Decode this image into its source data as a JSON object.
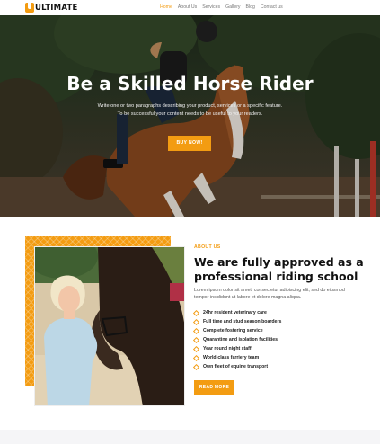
{
  "brand": {
    "logo_letter": "U",
    "name": "ULTIMATE"
  },
  "nav": [
    {
      "label": "Home",
      "active": true
    },
    {
      "label": "About Us",
      "active": false
    },
    {
      "label": "Services",
      "active": false
    },
    {
      "label": "Gallery",
      "active": false
    },
    {
      "label": "Blog",
      "active": false
    },
    {
      "label": "Contact us",
      "active": false
    }
  ],
  "hero": {
    "title": "Be a Skilled Horse Rider",
    "text_line1": "Write one or two paragraphs describing your product, services or a specific feature.",
    "text_line2": "To be successful your content needs to be useful to your readers.",
    "button": "BUY NOW!"
  },
  "about": {
    "eyebrow": "ABOUT US",
    "title": "We are fully approved as a professional riding school",
    "text": "Lorem ipsum dolor sit amet, consectetur adipiscing elit, sed do eiusmod tempor incididunt ut labore et dolore magna aliqua.",
    "features": [
      "24hr resident veterinary care",
      "Full time and stud season boarders",
      "Complete fostering service",
      "Quarantine and isolation facilities",
      "Year round night staff",
      "World-class farriery team",
      "Own fleet of equine transport"
    ],
    "button": "READ MORE"
  },
  "colors": {
    "accent": "#f39c12",
    "heading": "#111111",
    "body_text": "#555555"
  }
}
